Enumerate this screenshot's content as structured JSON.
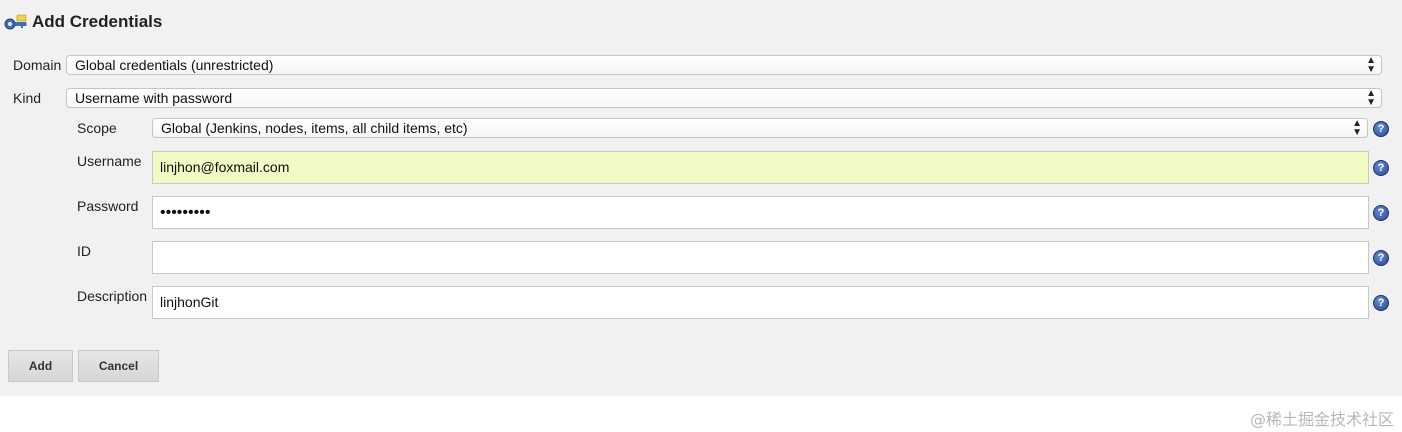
{
  "dialog": {
    "title": "Add Credentials",
    "title_icon": "credentials-key-icon"
  },
  "form": {
    "domain": {
      "label": "Domain",
      "value": "Global credentials (unrestricted)"
    },
    "kind": {
      "label": "Kind",
      "value": "Username with password"
    },
    "scope": {
      "label": "Scope",
      "value": "Global (Jenkins, nodes, items, all child items, etc)"
    },
    "username": {
      "label": "Username",
      "value": "linjhon@foxmail.com"
    },
    "password": {
      "label": "Password",
      "value": "•••••••••"
    },
    "id": {
      "label": "ID",
      "value": ""
    },
    "description": {
      "label": "Description",
      "value": "linjhonGit"
    }
  },
  "buttons": {
    "add": "Add",
    "cancel": "Cancel"
  },
  "help_glyph": "?",
  "select_arrows": {
    "up": "▲",
    "down": "▼"
  },
  "watermark": "@稀土掘金技术社区",
  "colors": {
    "autofill": "#f2f9c2",
    "help_icon": "#2f55a4",
    "panel": "#f1f1f1"
  }
}
